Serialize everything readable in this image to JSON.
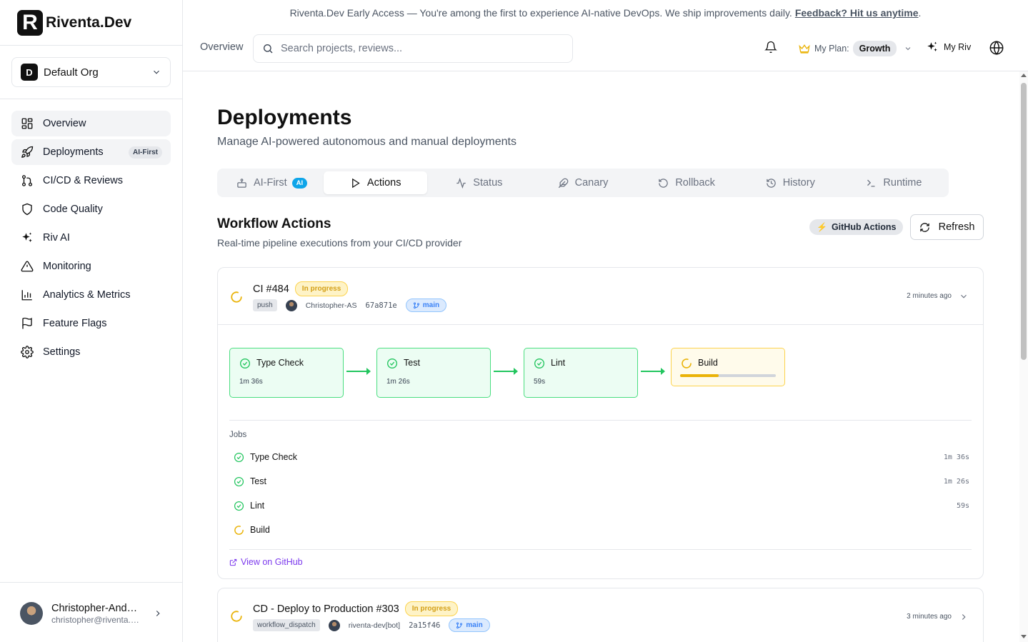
{
  "brand": {
    "mark": "R",
    "name": "Riventa.Dev"
  },
  "org": {
    "badge": "D",
    "name": "Default Org"
  },
  "sidebar": {
    "items": [
      {
        "label": "Overview",
        "icon": "layout-grid-icon"
      },
      {
        "label": "Deployments",
        "icon": "rocket-icon",
        "badge": "AI-First"
      },
      {
        "label": "CI/CD & Reviews",
        "icon": "git-pull-request-icon"
      },
      {
        "label": "Code Quality",
        "icon": "shield-icon"
      },
      {
        "label": "Riv AI",
        "icon": "sparkles-icon"
      },
      {
        "label": "Monitoring",
        "icon": "alert-triangle-icon"
      },
      {
        "label": "Analytics & Metrics",
        "icon": "bar-chart-icon"
      },
      {
        "label": "Feature Flags",
        "icon": "flag-icon"
      },
      {
        "label": "Settings",
        "icon": "gear-icon"
      }
    ]
  },
  "user": {
    "name": "Christopher-Ande…",
    "email": "christopher@riventa.…"
  },
  "banner": {
    "text": "Riventa.Dev Early Access — You're among the first to experience AI-native DevOps. We ship improvements daily.",
    "link": "Feedback? Hit us anytime",
    "end": "."
  },
  "header": {
    "breadcrumb": "Overview",
    "search_placeholder": "Search projects, reviews...",
    "plan_label": "My Plan:",
    "plan_value": "Growth",
    "myriv": "My Riv"
  },
  "page": {
    "title": "Deployments",
    "subtitle": "Manage AI-powered autonomous and manual deployments"
  },
  "tabs": [
    {
      "label": "AI-First",
      "badge": "AI",
      "icon": "bot-icon"
    },
    {
      "label": "Actions",
      "icon": "play-icon",
      "active": true
    },
    {
      "label": "Status",
      "icon": "activity-icon"
    },
    {
      "label": "Canary",
      "icon": "feather-icon"
    },
    {
      "label": "Rollback",
      "icon": "rotate-ccw-icon"
    },
    {
      "label": "History",
      "icon": "history-icon"
    },
    {
      "label": "Runtime",
      "icon": "terminal-icon"
    }
  ],
  "section": {
    "title": "Workflow Actions",
    "subtitle": "Real-time pipeline executions from your CI/CD provider",
    "provider_badge": "GitHub Actions",
    "refresh_label": "Refresh"
  },
  "runs": [
    {
      "title": "CI #484",
      "status": "In progress",
      "event": "push",
      "actor": "Christopher-AS",
      "sha": "67a871e",
      "branch": "main",
      "time": "2 minutes ago",
      "stages": [
        {
          "name": "Type Check",
          "duration": "1m 36s",
          "state": "success"
        },
        {
          "name": "Test",
          "duration": "1m 26s",
          "state": "success"
        },
        {
          "name": "Lint",
          "duration": "59s",
          "state": "success"
        },
        {
          "name": "Build",
          "duration": "",
          "state": "running",
          "progress": 0.4
        }
      ],
      "jobs_label": "Jobs",
      "jobs": [
        {
          "name": "Type Check",
          "duration": "1m 36s",
          "state": "success"
        },
        {
          "name": "Test",
          "duration": "1m 26s",
          "state": "success"
        },
        {
          "name": "Lint",
          "duration": "59s",
          "state": "success"
        },
        {
          "name": "Build",
          "duration": "",
          "state": "running"
        }
      ],
      "link": "View on GitHub"
    },
    {
      "title": "CD - Deploy to Production #303",
      "status": "In progress",
      "event": "workflow_dispatch",
      "actor": "riventa-dev[bot]",
      "sha": "2a15f46",
      "branch": "main",
      "time": "3 minutes ago"
    }
  ],
  "colors": {
    "success": "#22c55e",
    "running": "#eab308",
    "accent_blue": "#0ea5e9",
    "link_purple": "#7c3aed"
  }
}
